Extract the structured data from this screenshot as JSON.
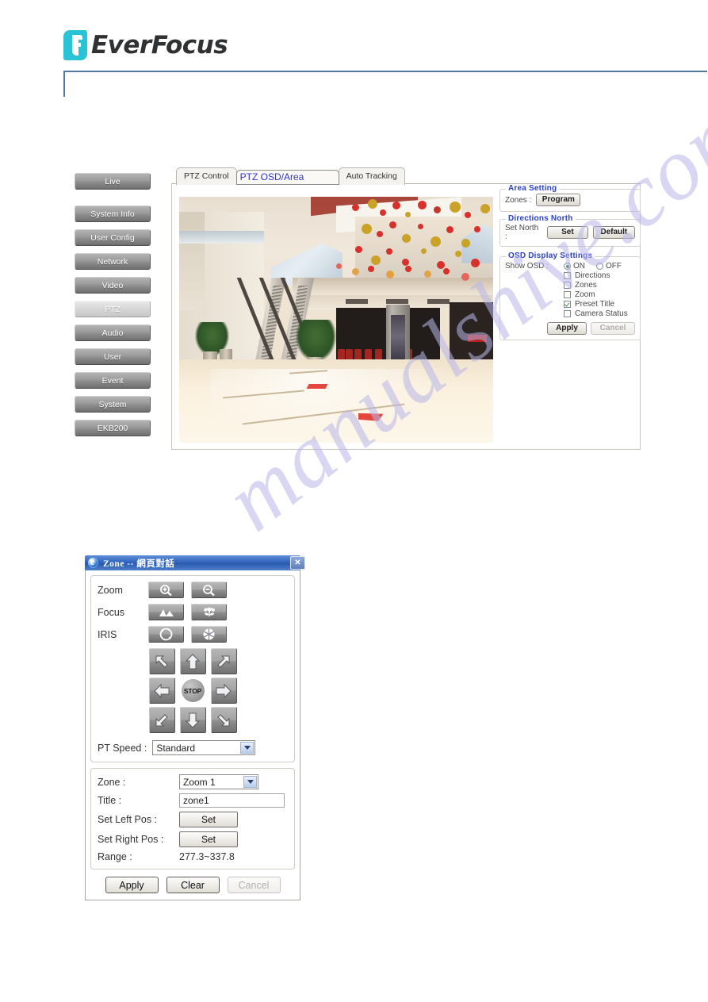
{
  "brand": {
    "name": "EverFocus",
    "logo_icon": "everfocus-f-logo-icon",
    "accent_hex": "#29c3d6",
    "rule_hex": "#53789c"
  },
  "watermark": {
    "text": "manualshive.com"
  },
  "sidebar": {
    "items": [
      {
        "label": "Live",
        "active": false
      },
      {
        "label": "System Info",
        "active": false
      },
      {
        "label": "User Config",
        "active": false
      },
      {
        "label": "Network",
        "active": false
      },
      {
        "label": "Video",
        "active": false
      },
      {
        "label": "PTZ",
        "active": true
      },
      {
        "label": "Audio",
        "active": false
      },
      {
        "label": "User",
        "active": false
      },
      {
        "label": "Event",
        "active": false
      },
      {
        "label": "System",
        "active": false
      },
      {
        "label": "EKB200",
        "active": false
      }
    ]
  },
  "tabs": [
    {
      "label": "PTZ Control",
      "selected": false
    },
    {
      "label": "PTZ OSD/Area",
      "selected": true
    },
    {
      "label": "Auto Tracking",
      "selected": false
    }
  ],
  "video_preview": {
    "alt": "Live camera view of shopping mall atrium with escalators and hanging red and gold decorations"
  },
  "settings": {
    "area_setting": {
      "legend": "Area Setting",
      "zones_label": "Zones :",
      "program_button": "Program"
    },
    "directions_north": {
      "legend": "Directions North",
      "set_north_label": "Set North :",
      "set_button": "Set",
      "default_button": "Default"
    },
    "osd": {
      "legend": "OSD Display Settings",
      "show_osd_label": "Show OSD :",
      "radio_on": "ON",
      "radio_off": "OFF",
      "selected_radio": "ON",
      "checkboxes": [
        {
          "label": "Directions",
          "checked": false
        },
        {
          "label": "Zones",
          "checked": false
        },
        {
          "label": "Zoom",
          "checked": false
        },
        {
          "label": "Preset Title",
          "checked": true
        },
        {
          "label": "Camera Status",
          "checked": false
        }
      ],
      "apply_button": "Apply",
      "cancel_button": "Cancel",
      "cancel_disabled": true
    }
  },
  "dialog": {
    "title": "Zone -- 網頁對話",
    "title_icon": "internet-explorer-icon",
    "close_label": "✕",
    "ptz": {
      "zoom_label": "Zoom",
      "zoom_in_icon": "magnifier-plus-icon",
      "zoom_out_icon": "magnifier-minus-icon",
      "focus_label": "Focus",
      "focus_far_icon": "mountain-icon",
      "focus_near_icon": "flower-icon",
      "iris_label": "IRIS",
      "iris_open_icon": "iris-open-icon",
      "iris_close_icon": "iris-close-icon",
      "pad": [
        "arrow-up-left-icon",
        "arrow-up-icon",
        "arrow-up-right-icon",
        "arrow-left-icon",
        "stop-button",
        "arrow-right-icon",
        "arrow-down-left-icon",
        "arrow-down-icon",
        "arrow-down-right-icon"
      ],
      "stop_label": "STOP",
      "pt_speed_label": "PT Speed :",
      "pt_speed_value": "Standard",
      "pt_speed_options": [
        "Standard"
      ]
    },
    "zone": {
      "zone_label": "Zone :",
      "zone_value": "Zoom 1",
      "zone_options": [
        "Zoom 1"
      ],
      "title_label": "Title :",
      "title_value": "zone1",
      "title_placeholder": "",
      "set_left_label": "Set Left Pos :",
      "set_left_button": "Set",
      "set_right_label": "Set Right Pos :",
      "set_right_button": "Set",
      "range_label": "Range :",
      "range_value": "277.3~337.8"
    },
    "actions": {
      "apply": "Apply",
      "clear": "Clear",
      "cancel": "Cancel",
      "cancel_disabled": true
    }
  }
}
